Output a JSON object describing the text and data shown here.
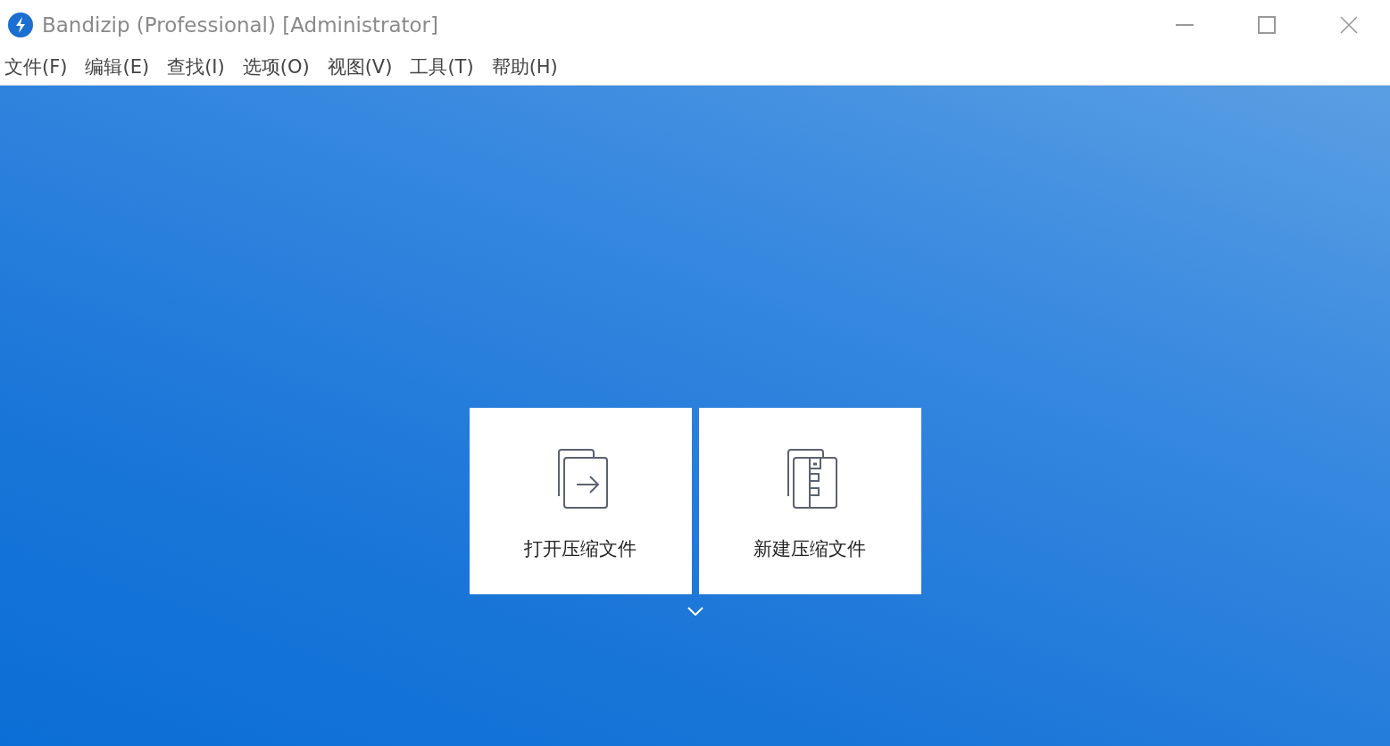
{
  "window": {
    "title": "Bandizip (Professional) [Administrator]"
  },
  "menu": [
    {
      "label": "文件(F)"
    },
    {
      "label": "编辑(E)"
    },
    {
      "label": "查找(I)"
    },
    {
      "label": "选项(O)"
    },
    {
      "label": "视图(V)"
    },
    {
      "label": "工具(T)"
    },
    {
      "label": "帮助(H)"
    }
  ],
  "actions": [
    {
      "kind": "open",
      "label": "打开压缩文件"
    },
    {
      "kind": "new",
      "label": "新建压缩文件"
    }
  ]
}
